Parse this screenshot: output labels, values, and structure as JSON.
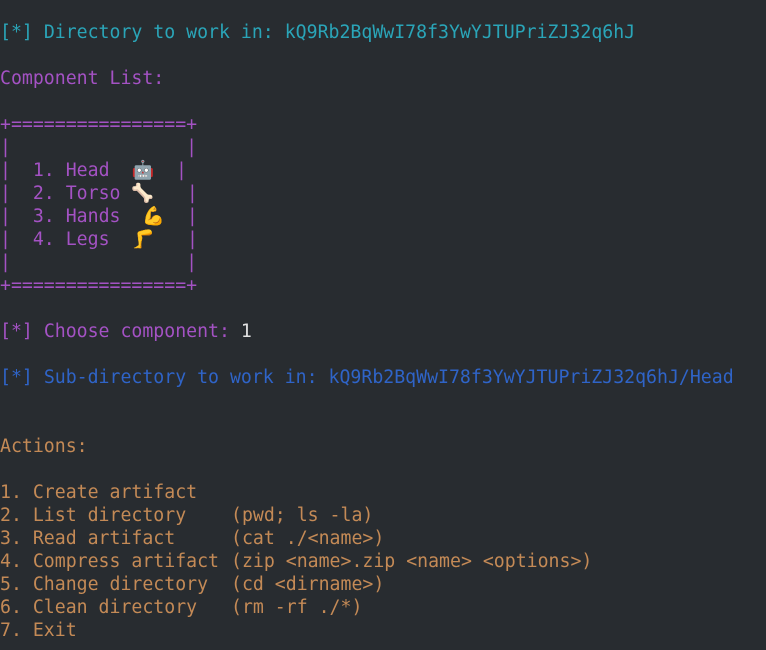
{
  "header": {
    "prefix": "[*]",
    "label": "Directory to work in:",
    "value": "kQ9Rb2BqWwI78f3YwYJTUPriZJ32q6hJ"
  },
  "component_list": {
    "title": "Component List:",
    "border_top": "+================+",
    "border_bottom": "+================+",
    "empty_line": "|                |",
    "items": [
      {
        "num": "1.",
        "name": "Head",
        "emoji": "🤖"
      },
      {
        "num": "2.",
        "name": "Torso",
        "emoji": "🦴"
      },
      {
        "num": "3.",
        "name": "Hands",
        "emoji": "💪"
      },
      {
        "num": "4.",
        "name": "Legs",
        "emoji": "🦵"
      }
    ]
  },
  "prompt": {
    "prefix": "[*]",
    "label": "Choose component:",
    "value": "1"
  },
  "subdir": {
    "prefix": "[*]",
    "label": "Sub-directory to work in:",
    "value": "kQ9Rb2BqWwI78f3YwYJTUPriZJ32q6hJ/Head"
  },
  "actions": {
    "title": "Actions:",
    "items": [
      {
        "text": "1. Create artifact",
        "cmd": ""
      },
      {
        "text": "2. List directory",
        "cmd": "(pwd; ls -la)"
      },
      {
        "text": "3. Read artifact",
        "cmd": "(cat ./<name>)"
      },
      {
        "text": "4. Compress artifact",
        "cmd": "(zip <name>.zip <name> <options>)"
      },
      {
        "text": "5. Change directory",
        "cmd": "(cd <dirname>)"
      },
      {
        "text": "6. Clean directory",
        "cmd": "(rm -rf ./*)"
      },
      {
        "text": "7. Exit",
        "cmd": ""
      }
    ]
  },
  "colors": {
    "background": "#282c30",
    "cyan": "#2aa5b8",
    "purple": "#a452c4",
    "blue": "#2f64c8",
    "orange": "#c48a56",
    "white": "#e2e2e2"
  }
}
